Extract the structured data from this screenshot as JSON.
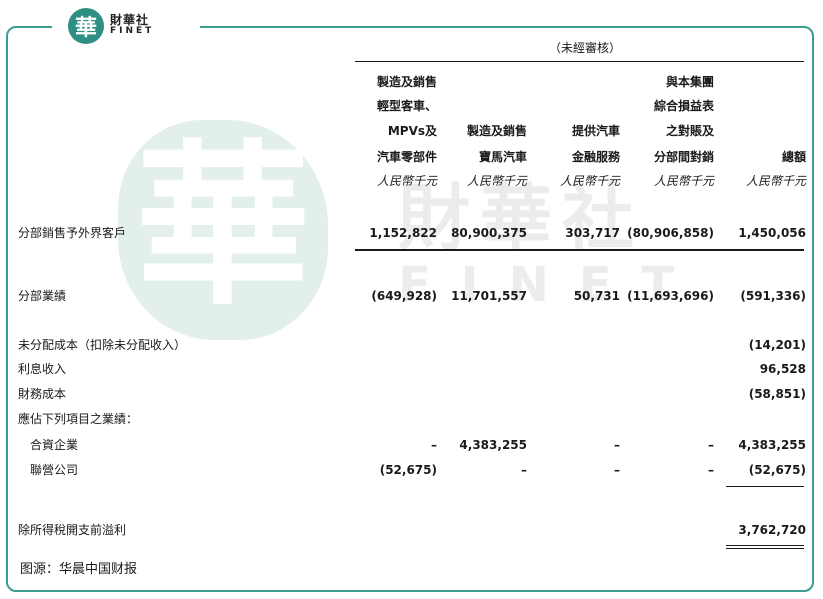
{
  "logo": {
    "char": "華",
    "cn": "財華社",
    "en": "FINET"
  },
  "watermark": {
    "char": "華",
    "cn": "財華社",
    "en": "FINET"
  },
  "table": {
    "unaudited": "（未經審核）",
    "columns": [
      {
        "lines": [
          "製造及銷售",
          "輕型客車、",
          "MPVs及",
          "汽車零部件"
        ],
        "unit": "人民幣千元"
      },
      {
        "lines": [
          "製造及銷售",
          "寶馬汽車"
        ],
        "unit": "人民幣千元"
      },
      {
        "lines": [
          "提供汽車",
          "金融服務"
        ],
        "unit": "人民幣千元"
      },
      {
        "lines": [
          "與本集團",
          "綜合損益表",
          "之對賬及",
          "分部間對銷"
        ],
        "unit": "人民幣千元"
      },
      {
        "lines": [
          "總額"
        ],
        "unit": "人民幣千元"
      }
    ],
    "rows": [
      {
        "label": "分部銷售予外界客戶",
        "values": [
          "1,152,822",
          "80,900,375",
          "303,717",
          "(80,906,858)",
          "1,450,056"
        ]
      },
      {
        "label": "分部業績",
        "values": [
          "(649,928)",
          "11,701,557",
          "50,731",
          "(11,693,696)",
          "(591,336)"
        ]
      },
      {
        "label": "未分配成本（扣除未分配收入）",
        "values": [
          "",
          "",
          "",
          "",
          "(14,201)"
        ]
      },
      {
        "label": "利息收入",
        "values": [
          "",
          "",
          "",
          "",
          "96,528"
        ]
      },
      {
        "label": "財務成本",
        "values": [
          "",
          "",
          "",
          "",
          "(58,851)"
        ]
      },
      {
        "label": "應佔下列項目之業績：",
        "values": [
          "",
          "",
          "",
          "",
          ""
        ]
      },
      {
        "label": "合資企業",
        "values": [
          "–",
          "4,383,255",
          "–",
          "–",
          "4,383,255"
        ]
      },
      {
        "label": "聯營公司",
        "values": [
          "(52,675)",
          "–",
          "–",
          "–",
          "(52,675)"
        ]
      },
      {
        "label": "除所得稅開支前溢利",
        "values": [
          "",
          "",
          "",
          "",
          "3,762,720"
        ]
      }
    ]
  },
  "source": "图源：华晨中国财报"
}
